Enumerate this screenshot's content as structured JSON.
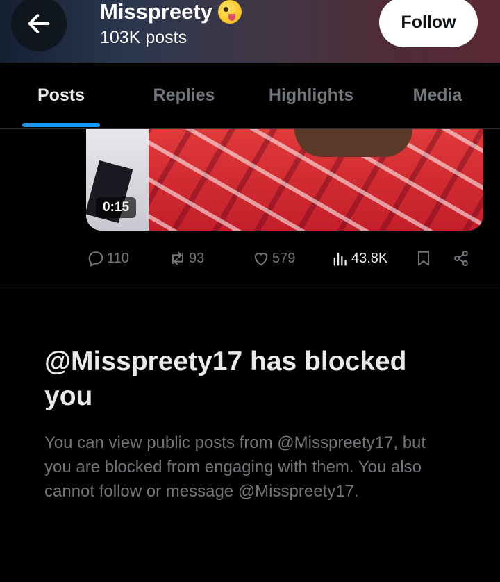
{
  "header": {
    "back_icon": "arrow-left-icon",
    "profile_name": "Misspreety",
    "name_emoji": "zany-face-emoji",
    "post_count": "103K posts",
    "follow_label": "Follow"
  },
  "tabs": [
    {
      "label": "Posts",
      "active": true
    },
    {
      "label": "Replies",
      "active": false
    },
    {
      "label": "Highlights",
      "active": false
    },
    {
      "label": "Media",
      "active": false
    }
  ],
  "post": {
    "video_duration": "0:15",
    "actions": {
      "replies": "110",
      "reposts": "93",
      "likes": "579",
      "views": "43.8K"
    },
    "icons": [
      "reply-icon",
      "repost-icon",
      "like-icon",
      "views-icon",
      "bookmark-icon",
      "share-icon"
    ]
  },
  "blocked_notice": {
    "title": "@Misspreety17 has blocked you",
    "body": "You can view public posts from @Misspreety17, but you are blocked from engaging with them. You also cannot follow or message @Misspreety17."
  },
  "colors": {
    "accent": "#1d9bf0",
    "background": "#000000",
    "muted_text": "#71767b",
    "primary_text": "#e7e9ea"
  }
}
